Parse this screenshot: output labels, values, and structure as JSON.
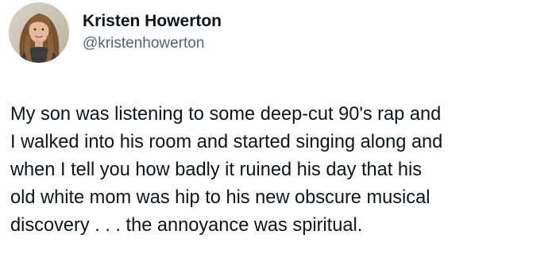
{
  "tweet": {
    "author": {
      "display_name": "Kristen Howerton",
      "handle": "@kristenhowerton",
      "avatar_icon": "profile-photo"
    },
    "text": "My son was listening to some deep-cut 90's rap and\nI walked into his room and started singing along and\nwhen I tell you how badly it ruined his day that his\nold white mom was hip to his new obscure musical\ndiscovery . . . the annoyance was spiritual."
  },
  "colors": {
    "text_primary": "#0f1419",
    "text_secondary": "#536471",
    "background": "#ffffff"
  }
}
